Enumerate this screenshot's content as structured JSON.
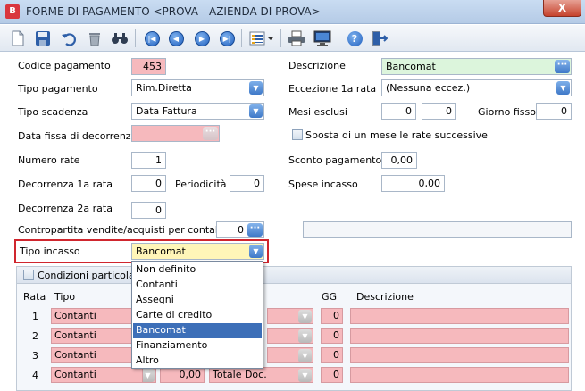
{
  "window": {
    "title": "FORME DI PAGAMENTO <PROVA - AZIENDA DI PROVA>",
    "close_label": "X"
  },
  "toolbar": {
    "icons": [
      "new-icon",
      "save-icon",
      "undo-icon",
      "delete-icon",
      "find-icon",
      "first-icon",
      "prev-icon",
      "next-icon",
      "last-icon",
      "list-icon",
      "print-icon",
      "preview-icon",
      "help-icon",
      "exit-icon"
    ]
  },
  "form": {
    "codice_label": "Codice pagamento",
    "codice_value": "453",
    "descrizione_label": "Descrizione",
    "descrizione_value": "Bancomat",
    "tipo_pag_label": "Tipo pagamento",
    "tipo_pag_value": "Rim.Diretta",
    "eccezione_label": "Eccezione 1a rata",
    "eccezione_value": "(Nessuna eccez.)",
    "tipo_scad_label": "Tipo scadenza",
    "tipo_scad_value": "Data Fattura",
    "mesi_label": "Mesi esclusi",
    "mesi_value1": "0",
    "mesi_value2": "0",
    "giorno_label": "Giorno fisso",
    "giorno_value": "0",
    "data_fissa_label": "Data fissa di decorrenza",
    "data_fissa_value": "",
    "sposta_label": "Sposta di un mese le rate successive",
    "num_rate_label": "Numero rate",
    "num_rate_value": "1",
    "sconto_label": "Sconto pagamento",
    "sconto_value": "0,00",
    "dec1_label": "Decorrenza 1a rata",
    "dec1_value": "0",
    "periodicita_label": "Periodicità",
    "periodicita_value": "0",
    "spese_label": "Spese incasso",
    "spese_value": "0,00",
    "dec2_label": "Decorrenza 2a rata",
    "dec2_value": "0",
    "contro_label": "Contropartita vendite/acquisti per contabilizz.",
    "contro_value": "0",
    "tipo_incasso_label": "Tipo incasso",
    "tipo_incasso_value": "Bancomat"
  },
  "conditions": {
    "header_label": "Condizioni particolari:",
    "col_rata": "Rata",
    "col_tipo": "Tipo",
    "col_gg": "GG",
    "col_descr": "Descrizione",
    "rows": [
      {
        "rata": "1",
        "tipo": "Contanti",
        "gg": "0",
        "amount": "",
        "base": ""
      },
      {
        "rata": "2",
        "tipo": "Contanti",
        "gg": "0",
        "amount": "",
        "base": ""
      },
      {
        "rata": "3",
        "tipo": "Contanti",
        "gg": "0",
        "amount": "",
        "base": ""
      },
      {
        "rata": "4",
        "tipo": "Contanti",
        "gg": "0",
        "amount": "0,00",
        "base": "Totale Doc."
      }
    ]
  },
  "dropdown": {
    "options": [
      "Non definito",
      "Contanti",
      "Assegni",
      "Carte di credito",
      "Bancomat",
      "Finanziamento",
      "Altro"
    ],
    "selected": "Bancomat"
  },
  "colors": {
    "required_field": "#f6b9bd",
    "selected_option": "#3d6fb8",
    "highlight_border": "#d0262e"
  }
}
